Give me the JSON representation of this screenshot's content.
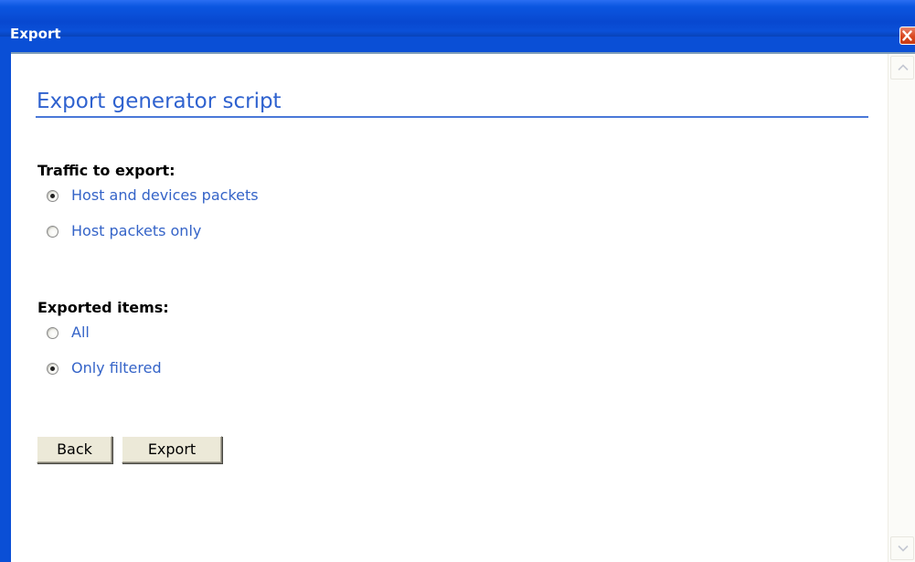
{
  "window": {
    "title": "Export"
  },
  "page": {
    "heading": "Export generator script"
  },
  "traffic": {
    "label": "Traffic to export:",
    "options": [
      {
        "label": "Host and devices packets",
        "checked": true
      },
      {
        "label": "Host packets only",
        "checked": false
      }
    ]
  },
  "items": {
    "label": "Exported items:",
    "options": [
      {
        "label": "All",
        "checked": false
      },
      {
        "label": "Only filtered",
        "checked": true
      }
    ]
  },
  "buttons": {
    "back": "Back",
    "export": "Export"
  },
  "icons": {
    "close": "close-icon",
    "scroll_up": "chevron-up-icon",
    "scroll_down": "chevron-down-icon"
  },
  "colors": {
    "title_bar": "#0848d0",
    "heading": "#2f62cf",
    "option_text": "#3564c8",
    "close_button": "#d9481f"
  }
}
